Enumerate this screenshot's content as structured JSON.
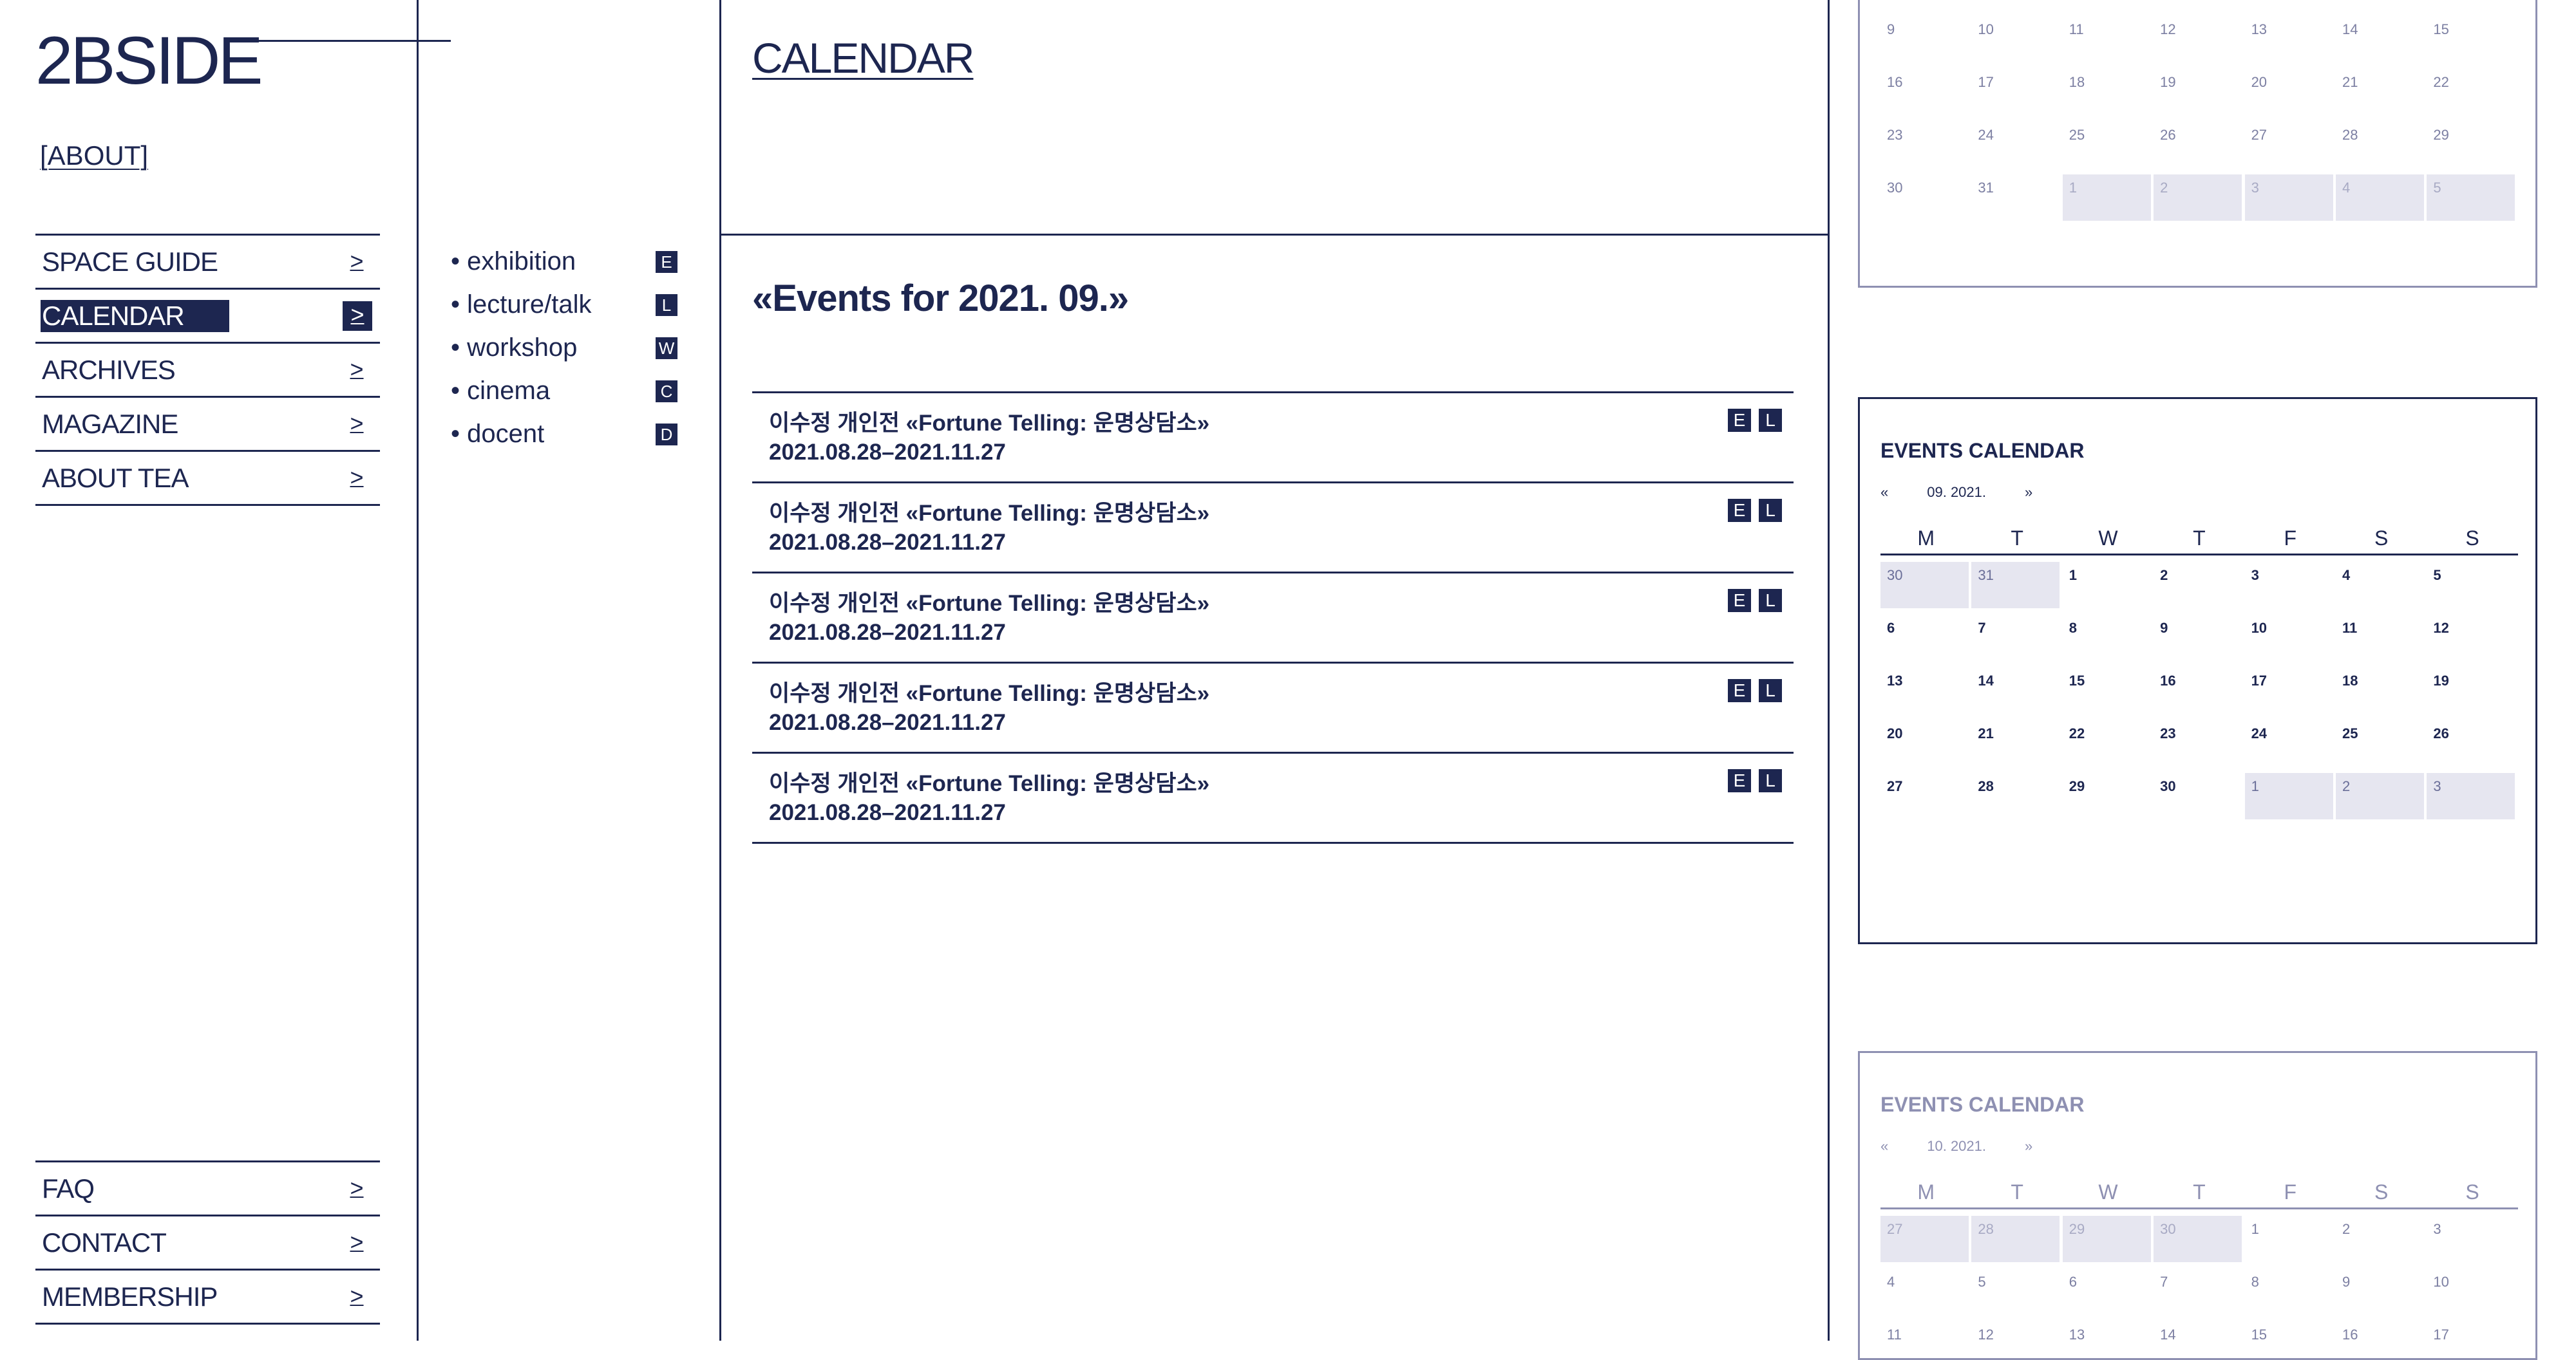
{
  "brand": {
    "logo": "2BSIDE",
    "about_link": "[ABOUT]"
  },
  "nav": {
    "primary": [
      {
        "label": "SPACE GUIDE",
        "arrow": ">"
      },
      {
        "label": "CALENDAR",
        "arrow": ">",
        "active": true
      },
      {
        "label": "ARCHIVES",
        "arrow": ">"
      },
      {
        "label": "MAGAZINE",
        "arrow": ">"
      },
      {
        "label": "ABOUT TEA",
        "arrow": ">"
      }
    ],
    "secondary": [
      {
        "label": "FAQ",
        "arrow": ">"
      },
      {
        "label": "CONTACT",
        "arrow": ">"
      },
      {
        "label": "MEMBERSHIP",
        "arrow": ">"
      }
    ]
  },
  "categories": [
    {
      "label": "• exhibition",
      "badge": "E"
    },
    {
      "label": "• lecture/talk",
      "badge": "L"
    },
    {
      "label": "• workshop",
      "badge": "W"
    },
    {
      "label": "• cinema",
      "badge": "C"
    },
    {
      "label": "• docent",
      "badge": "D"
    }
  ],
  "main": {
    "heading": "CALENDAR",
    "events_title": "«Events for 2021. 09.»",
    "events": [
      {
        "name": "이수정 개인전 «Fortune Telling: 운명상담소»",
        "date": "2021.08.28–2021.11.27",
        "badges": [
          "E",
          "L"
        ]
      },
      {
        "name": "이수정 개인전 «Fortune Telling: 운명상담소»",
        "date": "2021.08.28–2021.11.27",
        "badges": [
          "E",
          "L"
        ]
      },
      {
        "name": "이수정 개인전 «Fortune Telling: 운명상담소»",
        "date": "2021.08.28–2021.11.27",
        "badges": [
          "E",
          "L"
        ]
      },
      {
        "name": "이수정 개인전 «Fortune Telling: 운명상담소»",
        "date": "2021.08.28–2021.11.27",
        "badges": [
          "E",
          "L"
        ]
      },
      {
        "name": "이수정 개인전 «Fortune Telling: 운명상담소»",
        "date": "2021.08.28–2021.11.27",
        "badges": [
          "E",
          "L"
        ]
      }
    ]
  },
  "calendars": [
    {
      "title": "",
      "prev": "",
      "month_label": "",
      "next": "",
      "weekdays": [],
      "rows": [
        [
          {
            "d": "9"
          },
          {
            "d": "10"
          },
          {
            "d": "11"
          },
          {
            "d": "12"
          },
          {
            "d": "13"
          },
          {
            "d": "14"
          },
          {
            "d": "15"
          }
        ],
        [
          {
            "d": "16"
          },
          {
            "d": "17"
          },
          {
            "d": "18"
          },
          {
            "d": "19"
          },
          {
            "d": "20"
          },
          {
            "d": "21"
          },
          {
            "d": "22"
          }
        ],
        [
          {
            "d": "23"
          },
          {
            "d": "24"
          },
          {
            "d": "25"
          },
          {
            "d": "26"
          },
          {
            "d": "27"
          },
          {
            "d": "28"
          },
          {
            "d": "29"
          }
        ],
        [
          {
            "d": "30"
          },
          {
            "d": "31"
          },
          {
            "d": "1",
            "other": true
          },
          {
            "d": "2",
            "other": true
          },
          {
            "d": "3",
            "other": true
          },
          {
            "d": "4",
            "other": true
          },
          {
            "d": "5",
            "other": true
          }
        ]
      ]
    },
    {
      "title": "EVENTS CALENDAR",
      "prev": "«",
      "month_label": "09. 2021.",
      "next": "»",
      "weekdays": [
        "M",
        "T",
        "W",
        "T",
        "F",
        "S",
        "S"
      ],
      "rows": [
        [
          {
            "d": "30",
            "other": true
          },
          {
            "d": "31",
            "other": true
          },
          {
            "d": "1"
          },
          {
            "d": "2"
          },
          {
            "d": "3"
          },
          {
            "d": "4"
          },
          {
            "d": "5"
          }
        ],
        [
          {
            "d": "6"
          },
          {
            "d": "7"
          },
          {
            "d": "8"
          },
          {
            "d": "9"
          },
          {
            "d": "10"
          },
          {
            "d": "11"
          },
          {
            "d": "12"
          }
        ],
        [
          {
            "d": "13"
          },
          {
            "d": "14"
          },
          {
            "d": "15"
          },
          {
            "d": "16"
          },
          {
            "d": "17"
          },
          {
            "d": "18"
          },
          {
            "d": "19"
          }
        ],
        [
          {
            "d": "20"
          },
          {
            "d": "21"
          },
          {
            "d": "22"
          },
          {
            "d": "23"
          },
          {
            "d": "24"
          },
          {
            "d": "25"
          },
          {
            "d": "26"
          }
        ],
        [
          {
            "d": "27"
          },
          {
            "d": "28"
          },
          {
            "d": "29"
          },
          {
            "d": "30"
          },
          {
            "d": "1",
            "other": true
          },
          {
            "d": "2",
            "other": true
          },
          {
            "d": "3",
            "other": true
          }
        ]
      ]
    },
    {
      "title": "EVENTS CALENDAR",
      "prev": "«",
      "month_label": "10. 2021.",
      "next": "»",
      "weekdays": [
        "M",
        "T",
        "W",
        "T",
        "F",
        "S",
        "S"
      ],
      "rows": [
        [
          {
            "d": "27",
            "other": true
          },
          {
            "d": "28",
            "other": true
          },
          {
            "d": "29",
            "other": true
          },
          {
            "d": "30",
            "other": true
          },
          {
            "d": "1"
          },
          {
            "d": "2"
          },
          {
            "d": "3"
          }
        ],
        [
          {
            "d": "4"
          },
          {
            "d": "5"
          },
          {
            "d": "6"
          },
          {
            "d": "7"
          },
          {
            "d": "8"
          },
          {
            "d": "9"
          },
          {
            "d": "10"
          }
        ],
        [
          {
            "d": "11"
          },
          {
            "d": "12"
          },
          {
            "d": "13"
          },
          {
            "d": "14"
          },
          {
            "d": "15"
          },
          {
            "d": "16"
          },
          {
            "d": "17"
          }
        ]
      ]
    }
  ],
  "colors": {
    "ink": "#1d2650",
    "muted": "#8e90b2",
    "other_month_fill": "#e6e6f0",
    "background": "#ffffff"
  }
}
